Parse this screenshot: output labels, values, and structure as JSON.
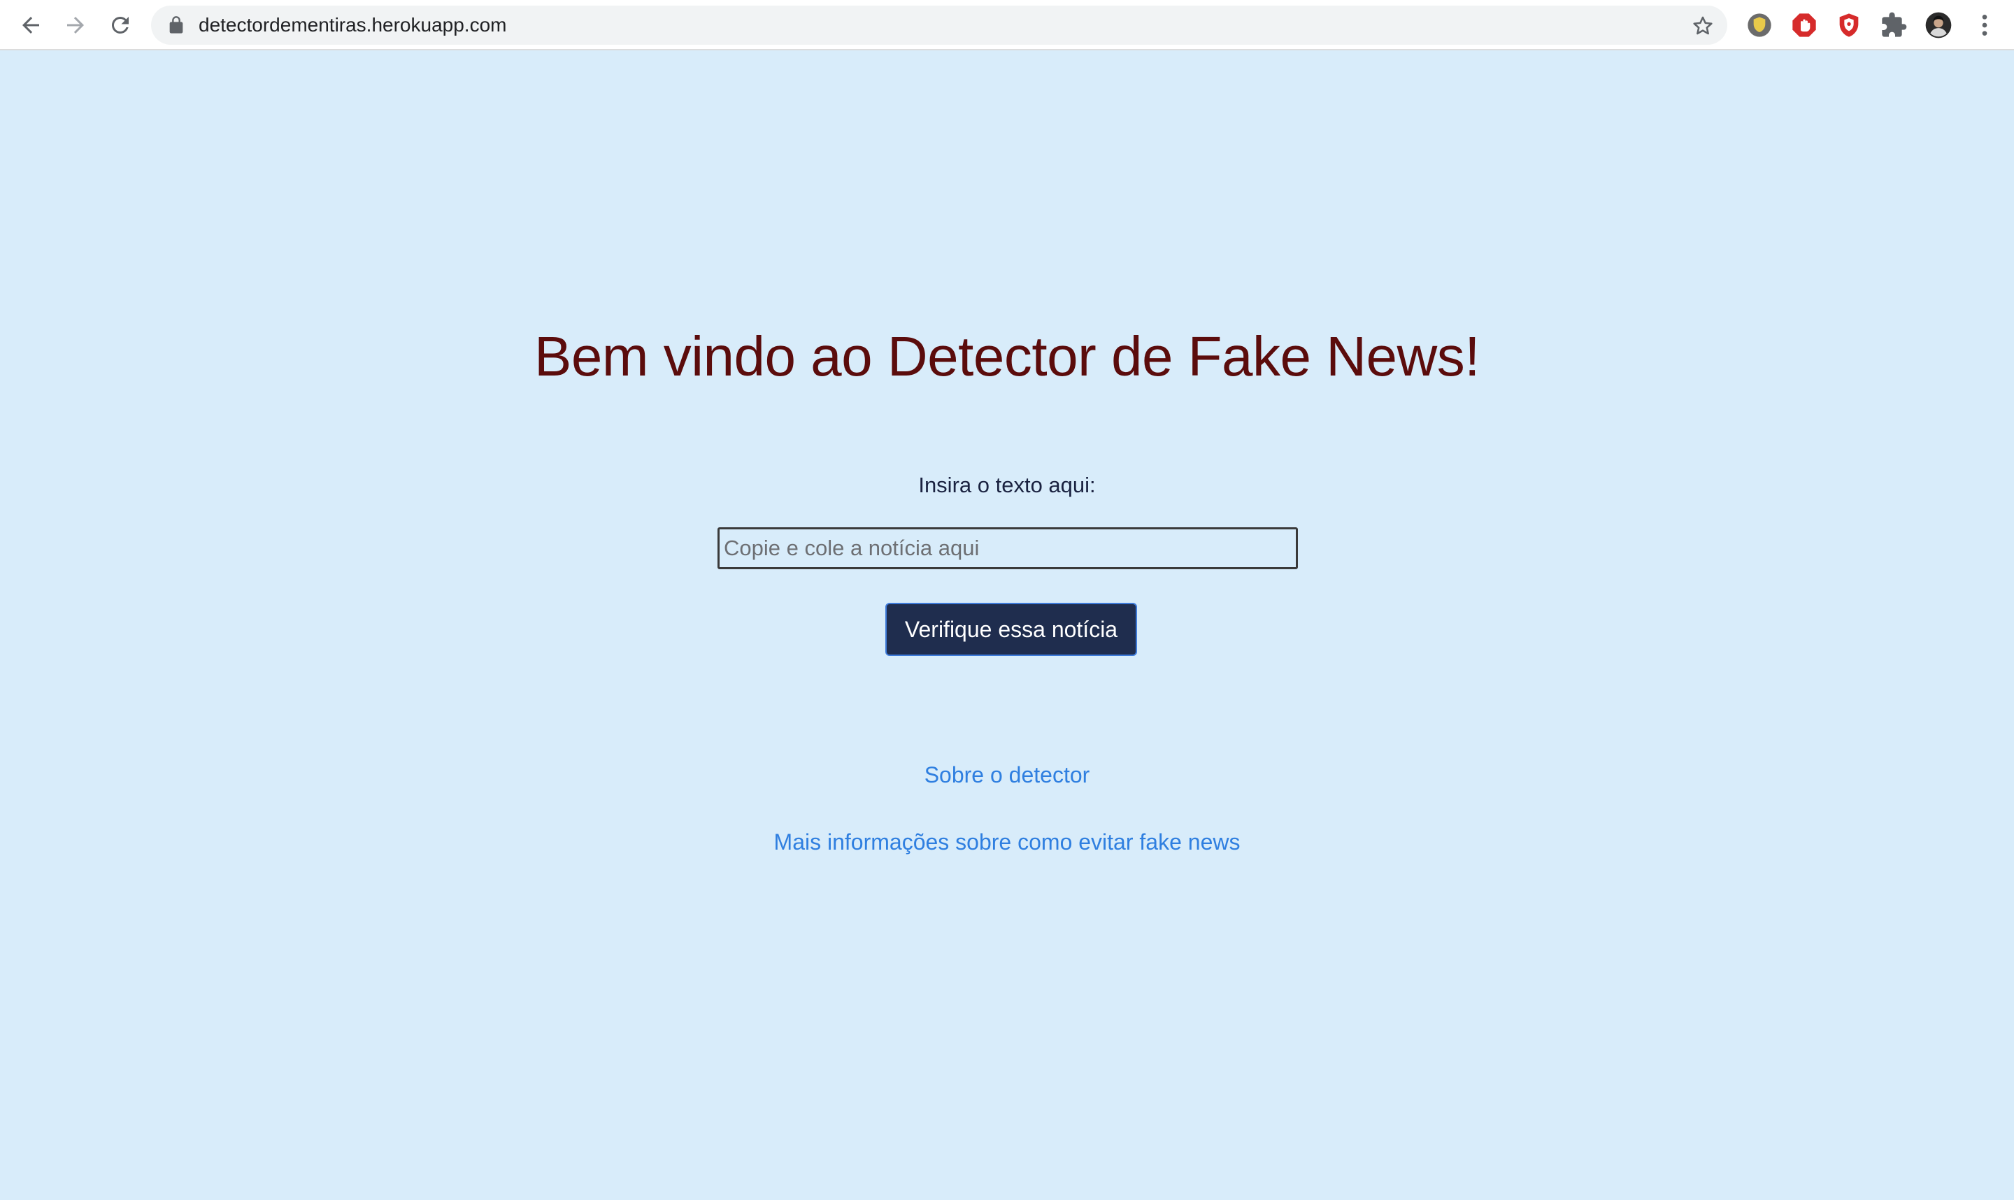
{
  "browser": {
    "url": "detectordementiras.herokuapp.com",
    "icons": {
      "back": "arrow-left-icon",
      "forward": "arrow-right-icon",
      "reload": "reload-icon",
      "lock": "lock-icon",
      "bookmark": "star-icon",
      "extensions": [
        "shield-extension-icon",
        "stop-hand-extension-icon",
        "red-shield-extension-icon",
        "puzzle-icon"
      ],
      "profile": "avatar",
      "menu": "kebab-menu-icon"
    }
  },
  "main": {
    "title": "Bem vindo ao Detector de Fake News!",
    "input_label": "Insira o texto aqui:",
    "input_placeholder": "Copie e cole a notícia aqui",
    "input_value": "",
    "submit_label": "Verifique essa notícia",
    "links": {
      "about": "Sobre o detector",
      "more_info": "Mais informações sobre como evitar fake news"
    }
  },
  "colors": {
    "background": "#d8ecfa",
    "title": "#5b0c0c",
    "button": "#1f2d4e",
    "link": "#2f7fe0"
  }
}
